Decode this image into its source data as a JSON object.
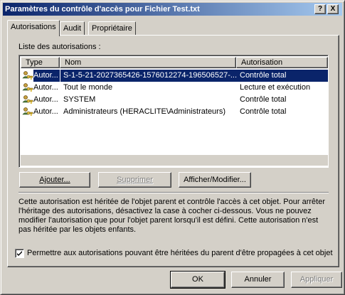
{
  "window": {
    "title": "Paramètres du contrôle d'accès pour Fichier Test.txt"
  },
  "titlebar_buttons": {
    "help": "?",
    "close": "X"
  },
  "tabs": [
    {
      "label": "Autorisations",
      "active": true
    },
    {
      "label": "Audit",
      "active": false
    },
    {
      "label": "Propriétaire",
      "active": false
    }
  ],
  "list": {
    "label": "Liste des autorisations :",
    "columns": [
      "Type",
      "Nom",
      "Autorisation"
    ],
    "rows": [
      {
        "icon": "users-key-icon",
        "type": "Autor...",
        "name": "S-1-5-21-2027365426-1576012274-196506527-...",
        "permission": "Contrôle total",
        "selected": true
      },
      {
        "icon": "users-key-icon",
        "type": "Autor...",
        "name": "Tout le monde",
        "permission": "Lecture et exécution",
        "selected": false
      },
      {
        "icon": "users-key-icon",
        "type": "Autor...",
        "name": "SYSTEM",
        "permission": "Contrôle total",
        "selected": false
      },
      {
        "icon": "users-key-icon",
        "type": "Autor...",
        "name": "Administrateurs (HERACLITE\\Administrateurs)",
        "permission": "Contrôle total",
        "selected": false
      }
    ]
  },
  "actions": {
    "add": "Ajouter...",
    "remove": "Supprimer",
    "view_edit": "Afficher/Modifier..."
  },
  "info_text": "Cette autorisation est héritée de l'objet parent et contrôle l'accès à cet objet. Pour arrêter l'héritage des autorisations, désactivez la case à cocher ci-dessous. Vous ne pouvez modifier l'autorisation que pour l'objet parent lorsqu'il est défini. Cette autorisation n'est pas héritée par les objets enfants.",
  "inherit_checkbox": {
    "label": "Permettre aux autorisations pouvant être héritées du parent d'être propagées à cet objet",
    "checked": true
  },
  "footer": {
    "ok": "OK",
    "cancel": "Annuler",
    "apply": "Appliquer"
  },
  "colors": {
    "title_start": "#0a246a",
    "title_end": "#a6caf0",
    "face": "#d4d0c8",
    "selection": "#0a246a"
  }
}
